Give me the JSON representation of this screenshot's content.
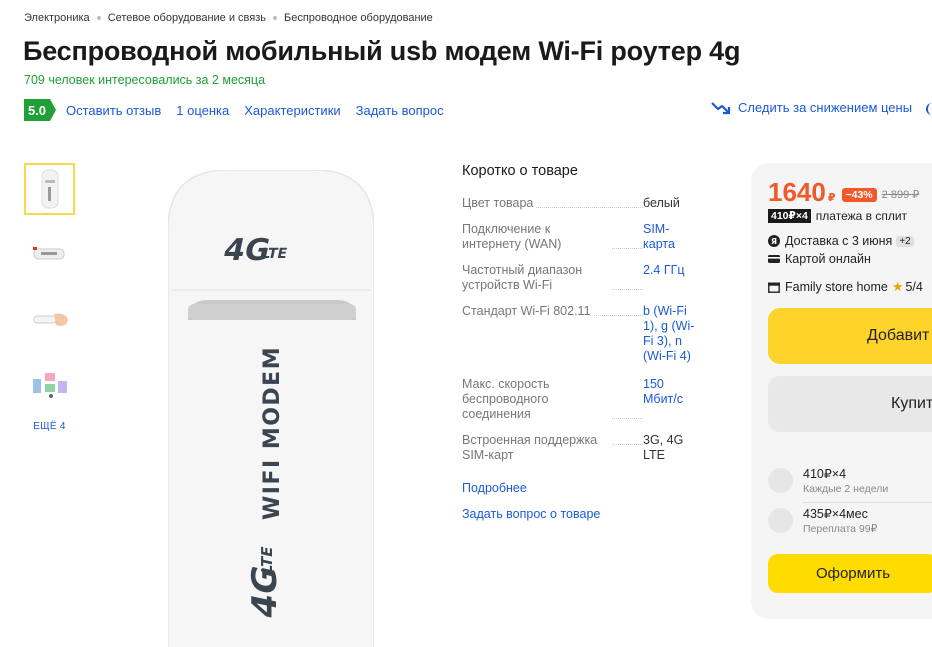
{
  "breadcrumbs": [
    "Электроника",
    "Сетевое оборудование и связь",
    "Беспроводное оборудование"
  ],
  "product": {
    "title": "Беспроводной мобильный usb модем Wi-Fi роутер 4g",
    "interest": "709 человек интересовались за 2 месяца",
    "rating": "5.0",
    "actions": {
      "review": "Оставить отзыв",
      "ratings_count": "1 оценка",
      "specs": "Характеристики",
      "ask": "Задать вопрос"
    },
    "track_price": "Следить за снижением цены",
    "device_text": {
      "main": "WIFI MODEM",
      "brand_4g": "4G",
      "brand_lte": "LTE"
    }
  },
  "gallery": {
    "more": "ЕЩЁ 4"
  },
  "short": {
    "heading": "Коротко о товаре",
    "specs": [
      {
        "key": "Цвет товара",
        "value": "белый",
        "link": false
      },
      {
        "key": "Подключение к интернету (WAN)",
        "value": "SIM-карта",
        "link": true
      },
      {
        "key": "Частотный диапазон устройств Wi-Fi",
        "value": "2.4 ГГц",
        "link": true
      },
      {
        "key": "Стандарт Wi-Fi 802.11",
        "value": "b (Wi-Fi 1), g (Wi-Fi 3), n (Wi-Fi 4)",
        "link": true
      },
      {
        "key": "Макс. скорость беспроводного соединения",
        "value": "150 Мбит/с",
        "link": true
      },
      {
        "key": "Встроенная поддержка SIM-карт",
        "value": "3G, 4G LTE",
        "link": false
      }
    ],
    "more_link": "Подробнее",
    "ask_link": "Задать вопрос о товаре"
  },
  "buy": {
    "price": "1640",
    "currency": "₽",
    "discount": "−43%",
    "old_price": "2 899 ₽",
    "split_badge": "410₽×4",
    "split_text": "платежа в сплит",
    "delivery": "Доставка с 3 июня",
    "delivery_plus": "+2",
    "payment": "Картой онлайн",
    "store": "Family store home",
    "store_rating": "5/4",
    "add_button": "Добавит",
    "buy_button": "Купит",
    "plans": [
      {
        "title": "410₽×4",
        "sub": "Каждые 2 недели"
      },
      {
        "title": "435₽×4мес",
        "sub": "Переплата 99₽"
      }
    ],
    "order_button": "Оформить"
  },
  "colors": {
    "accent": "#1a5ad7",
    "green": "#21a038",
    "price": "#f1592b",
    "yellow": "#fed42b"
  }
}
